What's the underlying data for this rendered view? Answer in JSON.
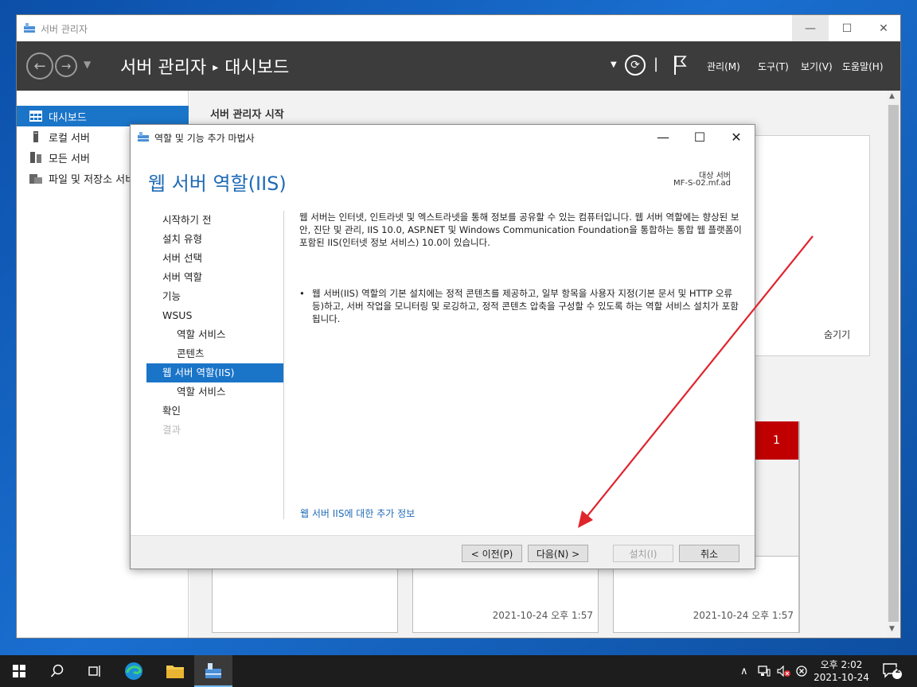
{
  "server_manager": {
    "window_title": "서버 관리자",
    "breadcrumb_app": "서버 관리자",
    "breadcrumb_sep": "▸",
    "breadcrumb_page": "대시보드",
    "menus": {
      "manage": "관리(M)",
      "tools": "도구(T)",
      "view": "보기(V)",
      "help": "도움말(H)"
    },
    "nav_items": [
      {
        "label": "대시보드",
        "icon": "dashboard-icon",
        "active": true
      },
      {
        "label": "로컬 서버",
        "icon": "local-server-icon"
      },
      {
        "label": "모든 서버",
        "icon": "all-servers-icon"
      },
      {
        "label": "파일 및 저장소 서비스",
        "icon": "file-storage-icon"
      }
    ],
    "main_title": "서버 관리자 시작",
    "hide_link": "숨기기",
    "red_tile_count": "1",
    "tile_timestamps": [
      "2021-10-24 오후 1:57",
      "2021-10-24 오후 1:57"
    ]
  },
  "wizard": {
    "title": "역할 및 기능 추가 마법사",
    "heading": "웹 서버 역할(IIS)",
    "target_label": "대상 서버",
    "target_value": "MF-S-02.mf.ad",
    "steps": [
      {
        "label": "시작하기 전"
      },
      {
        "label": "설치 유형"
      },
      {
        "label": "서버 선택"
      },
      {
        "label": "서버 역할"
      },
      {
        "label": "기능"
      },
      {
        "label": "WSUS"
      },
      {
        "label": "역할 서비스",
        "sub": true
      },
      {
        "label": "콘텐츠",
        "sub": true
      },
      {
        "label": "웹 서버 역할(IIS)",
        "active": true
      },
      {
        "label": "역할 서비스",
        "sub": true
      },
      {
        "label": "확인"
      },
      {
        "label": "결과",
        "disabled": true
      }
    ],
    "description": "웹 서버는 인터넷, 인트라넷 및 엑스트라넷을 통해 정보를 공유할 수 있는 컴퓨터입니다. 웹 서버 역할에는 향상된 보안, 진단 및 관리, IIS 10.0, ASP.NET 및 Windows Communication Foundation을 통합하는 통합 웹 플랫폼이 포함된 IIS(인터넷 정보 서비스) 10.0이 있습니다.",
    "bullet_marker": "•",
    "bullet": "웹 서버(IIS) 역할의 기본 설치에는 정적 콘텐츠를 제공하고, 일부 항목을 사용자 지정(기본 문서 및 HTTP 오류 등)하고, 서버 작업을 모니터링 및 로깅하고, 정적 콘텐츠 압축을 구성할 수 있도록 하는 역할 서비스 설치가 포함됩니다.",
    "more_info_link": "웹 서버 IIS에 대한 추가 정보",
    "buttons": {
      "prev": "< 이전(P)",
      "next": "다음(N) >",
      "install": "설치(I)",
      "cancel": "취소"
    }
  },
  "taskbar": {
    "time": "오후 2:02",
    "date": "2021-10-24",
    "notification_count": "2"
  },
  "colors": {
    "accent": "#1a74c8",
    "header_bg": "#3c3c3c",
    "annotation_arrow": "#e0242c",
    "alert_red": "#c00000"
  }
}
